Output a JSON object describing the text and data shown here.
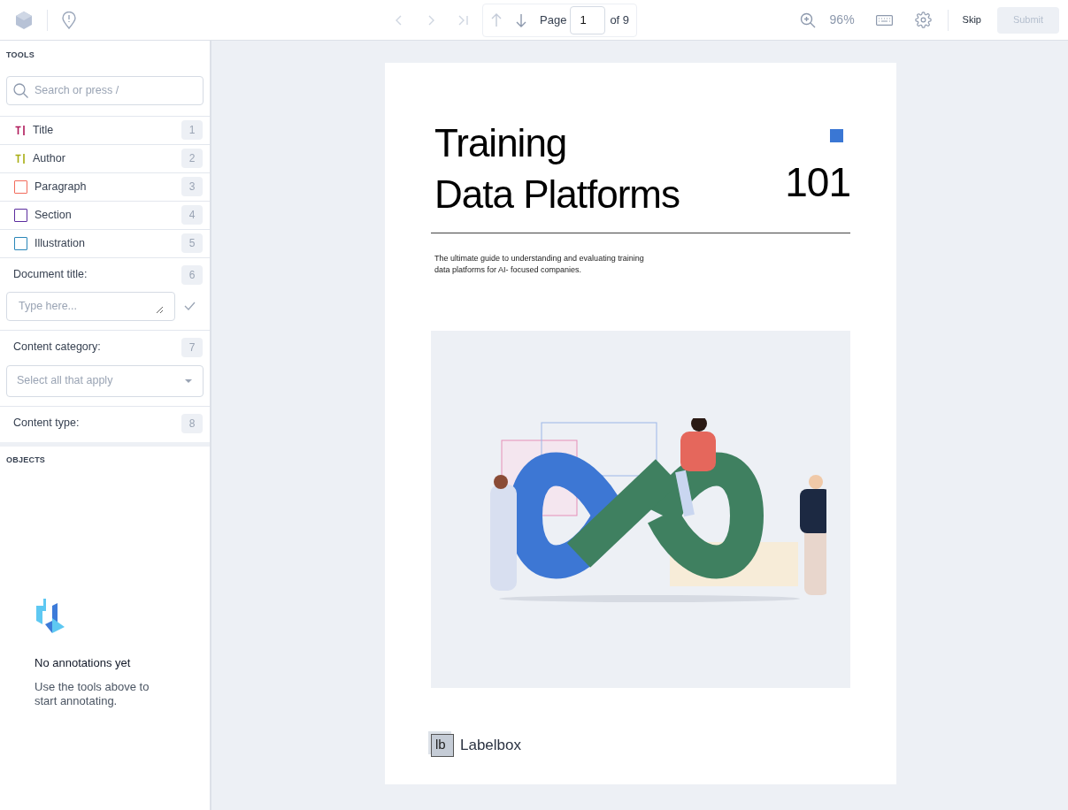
{
  "toolbar": {
    "page_label": "Page",
    "page_value": "1",
    "page_total": "of 9",
    "zoom": "96%",
    "skip": "Skip",
    "submit": "Submit"
  },
  "tools": {
    "heading": "TOOLS",
    "search": {
      "placeholder": "Search or press /"
    },
    "items": [
      {
        "kind": "text",
        "label": "Title",
        "color": "#b0195a",
        "shortcut": "1"
      },
      {
        "kind": "text",
        "label": "Author",
        "color": "#a8ad12",
        "shortcut": "2"
      },
      {
        "kind": "box",
        "label": "Paragraph",
        "color": "#f26b5b",
        "shortcut": "3"
      },
      {
        "kind": "box",
        "label": "Section",
        "color": "#5b2c9e",
        "shortcut": "4"
      },
      {
        "kind": "box",
        "label": "Illustration",
        "color": "#2a86b8",
        "shortcut": "5"
      }
    ],
    "questions": [
      {
        "kind": "text",
        "label": "Document title:",
        "shortcut": "6",
        "placeholder": "Type here..."
      },
      {
        "kind": "select",
        "label": "Content category:",
        "shortcut": "7",
        "placeholder": "Select all that apply"
      },
      {
        "kind": "none",
        "label": "Content type:",
        "shortcut": "8"
      }
    ]
  },
  "objects": {
    "heading": "OBJECTS",
    "empty_title": "No annotations yet",
    "empty_text": "Use the tools above to start annotating."
  },
  "document": {
    "title_line_1": "Training",
    "title_line_2": "Data Platforms",
    "number": "101",
    "subtitle": "The ultimate guide to understanding and evaluating training data platforms for AI- focused companies.",
    "logo_mark": "lb",
    "logo_text": "Labelbox"
  }
}
